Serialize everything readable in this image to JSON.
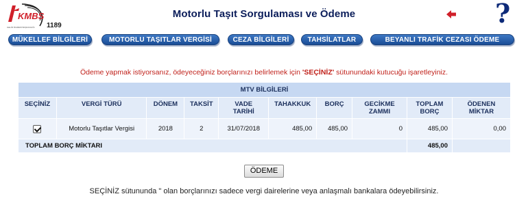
{
  "logo": {
    "name": "KMBS",
    "number": "1189",
    "tagline": "GELİR İDARESİ BAŞKANLIĞI"
  },
  "header": {
    "title": "Motorlu Taşıt Sorgulaması ve Ödeme",
    "help": "?"
  },
  "nav": [
    {
      "label": "MÜKELLEF BİLGİLERİ"
    },
    {
      "label": "MOTORLU TAŞITLAR VERGİSİ"
    },
    {
      "label": "CEZA BİLGİLERİ"
    },
    {
      "label": "TAHSİLATLAR"
    },
    {
      "label": "BEYANLI TRAFİK CEZASI ÖDEME"
    }
  ],
  "notice": {
    "before": "Ödeme yapmak istiyorsanız, ödeyeceğiniz borçlarınızı belirlemek için ",
    "highlight": "'SEÇİNİZ'",
    "after": " sütunundaki kutucuğu işaretleyiniz."
  },
  "table": {
    "caption": "MTV BİLGİLERİ",
    "headers": [
      "SEÇİNİZ",
      "VERGİ TÜRÜ",
      "DÖNEM",
      "TAKSİT",
      "VADE TARİHİ",
      "TAHAKKUK",
      "BORÇ",
      "GECİKME ZAMMI",
      "TOPLAM BORÇ",
      "ÖDENEN MİKTAR"
    ],
    "rows": [
      {
        "checked": true,
        "vergi_turu": "Motorlu Taşıtlar Vergisi",
        "donem": "2018",
        "taksit": "2",
        "vade_tarihi": "31/07/2018",
        "tahakkuk": "485,00",
        "borc": "485,00",
        "gecikme_zammi": "0",
        "toplam_borc": "485,00",
        "odenen_miktar": "0,00"
      }
    ],
    "total_label": "TOPLAM BORÇ MİKTARI",
    "total_value": "485,00"
  },
  "pay_button": "ÖDEME",
  "footnote": "SEÇİNİZ sütununda \" olan borçlarınızı sadece vergi dairelerine veya anlaşmalı bankalara ödeyebilirsiniz.",
  "colors": {
    "title": "#0b1d5a",
    "nav": "#1a4d96",
    "notice": "#c0201a",
    "back_arrow": "#d0202a",
    "table_caption": "#c6d8f2"
  }
}
